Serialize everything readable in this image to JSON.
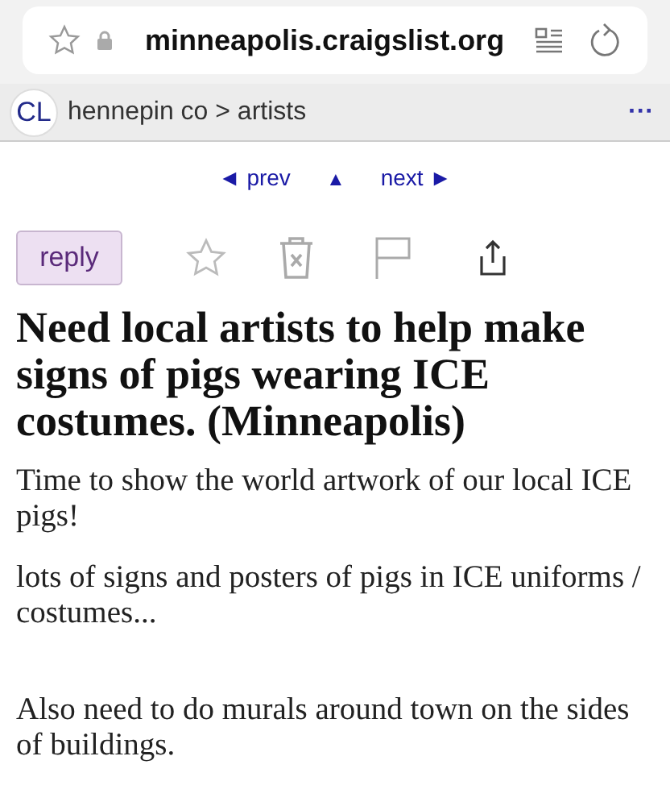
{
  "address_bar": {
    "url": "minneapolis.craigslist.org"
  },
  "breadcrumb": {
    "logo": "CL",
    "path": "hennepin co > artists",
    "menu": "···"
  },
  "nav": [
    {
      "kind": "prev",
      "label": "◄ prev"
    },
    {
      "kind": "up",
      "label": "▲"
    },
    {
      "kind": "next",
      "label": "next ►"
    }
  ],
  "reply_button": "reply",
  "post": {
    "title": "Need local artists to help make signs of pigs wearing ICE costumes. (Minneapolis)",
    "paragraphs": [
      {
        "text": "Time to show the world artwork of our local ICE pigs!"
      },
      {
        "text": "lots of signs and posters of pigs in ICE uniforms / costumes..."
      },
      {
        "text": "Also need to do murals around town on the sides of buildings."
      }
    ]
  }
}
